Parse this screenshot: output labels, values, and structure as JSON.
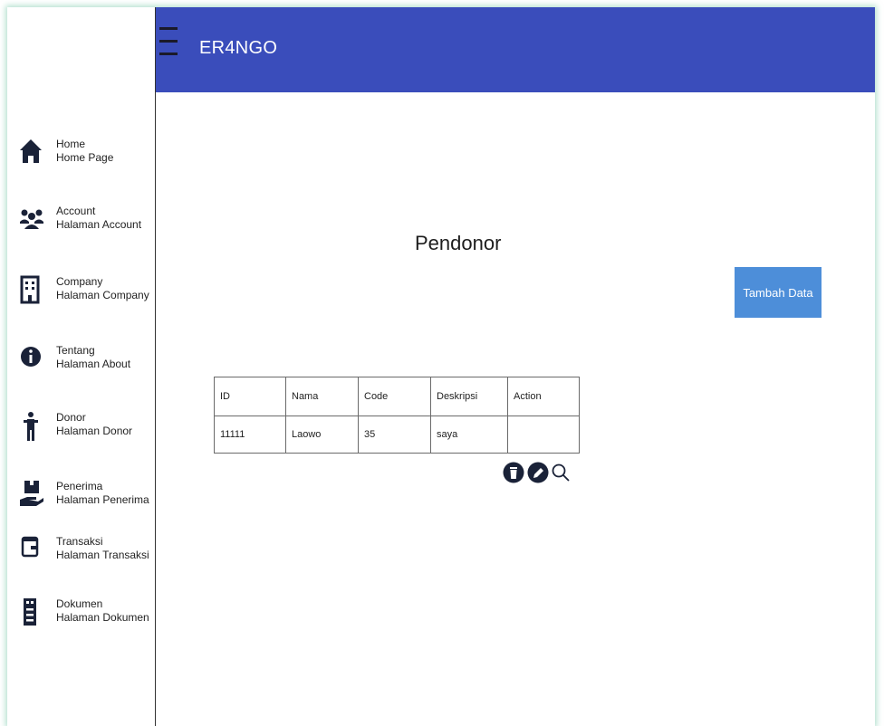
{
  "app": {
    "title": "ER4NGO"
  },
  "sidebar": {
    "items": [
      {
        "icon": "home-icon",
        "label": "Home",
        "sublabel": "Home Page"
      },
      {
        "icon": "account-group-icon",
        "label": "Account",
        "sublabel": "Halaman Account"
      },
      {
        "icon": "building-icon",
        "label": "Company",
        "sublabel": "Halaman Company"
      },
      {
        "icon": "info-icon",
        "label": "Tentang",
        "sublabel": "Halaman About"
      },
      {
        "icon": "person-standing-icon",
        "label": "Donor",
        "sublabel": "Halaman Donor"
      },
      {
        "icon": "hand-receive-icon",
        "label": "Penerima",
        "sublabel": "Halaman Penerima"
      },
      {
        "icon": "wallet-icon",
        "label": "Transaksi",
        "sublabel": "Halaman Transaksi"
      },
      {
        "icon": "document-icon",
        "label": "Dokumen",
        "sublabel": "Halaman Dokumen"
      }
    ]
  },
  "main": {
    "page_title": "Pendonor",
    "add_button_label": "Tambah Data",
    "table": {
      "headers": [
        "ID",
        "Nama",
        "Code",
        "Deskripsi",
        "Action"
      ],
      "rows": [
        [
          "11111",
          "Laowo",
          "35",
          "saya",
          ""
        ]
      ]
    },
    "row_actions": [
      "delete-icon",
      "edit-icon",
      "search-icon"
    ]
  },
  "colors": {
    "appbar": "#3a4dbb",
    "add_button": "#4d8ed9",
    "sidebar_icons": "#1a2238"
  }
}
